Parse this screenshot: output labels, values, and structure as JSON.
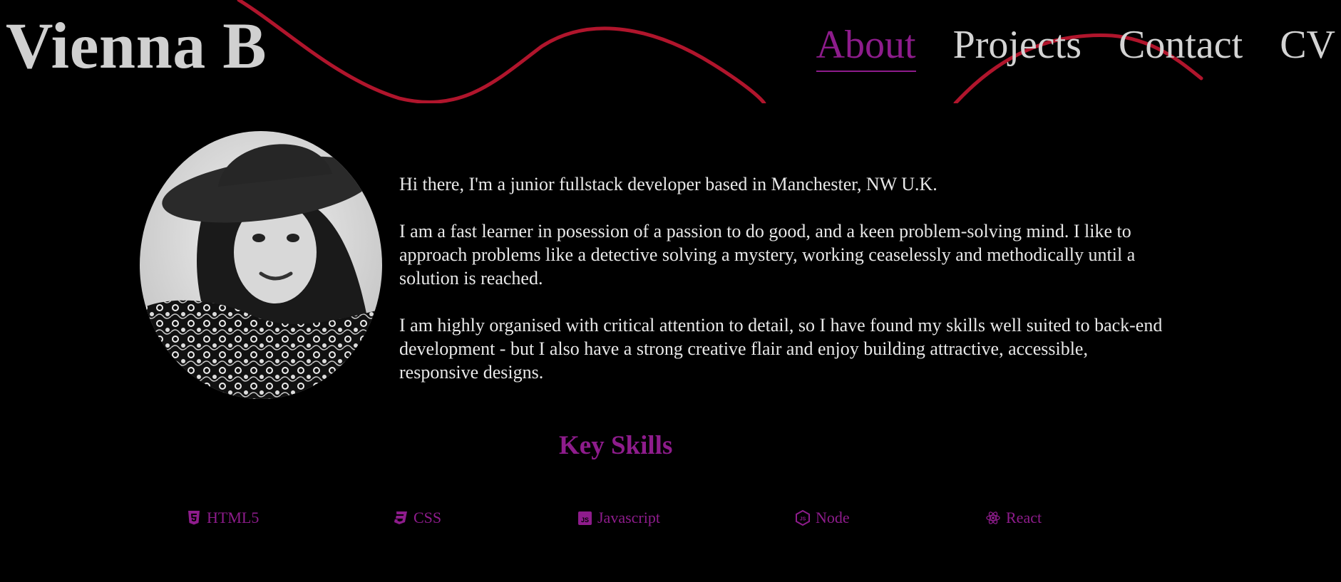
{
  "header": {
    "site_title": "Vienna B",
    "nav": [
      {
        "label": "About",
        "active": true
      },
      {
        "label": "Projects",
        "active": false
      },
      {
        "label": "Contact",
        "active": false
      },
      {
        "label": "CV",
        "active": false
      }
    ]
  },
  "about": {
    "paragraphs": [
      "Hi there, I'm a junior fullstack developer based in Manchester, NW U.K.",
      "I am a fast learner in posession of a passion to do good, and a keen problem-solving mind. I like to approach problems like a detective solving a mystery, working ceaselessly and methodically until a solution is reached.",
      "I am highly organised with critical attention to detail, so I have found my skills well suited to back-end development - but I also have a strong creative flair and enjoy building attractive, accessible, responsive designs."
    ]
  },
  "skills": {
    "heading": "Key Skills",
    "items": [
      {
        "label": "HTML5",
        "icon": "html5-icon"
      },
      {
        "label": "CSS",
        "icon": "css3-icon"
      },
      {
        "label": "Javascript",
        "icon": "javascript-icon"
      },
      {
        "label": "Node",
        "icon": "nodejs-icon"
      },
      {
        "label": "React",
        "icon": "react-icon"
      }
    ]
  },
  "colors": {
    "background": "#000000",
    "accent": "#8e1c8c",
    "wave": "#b0152c",
    "text": "#d4d4d4"
  }
}
